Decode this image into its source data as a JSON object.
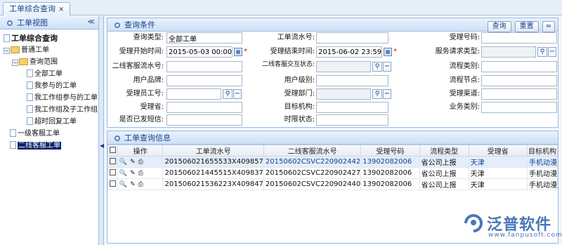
{
  "tab": {
    "title": "工单综合查询",
    "close": "×"
  },
  "left": {
    "title": "工单视图",
    "collapse": "≪",
    "tree": [
      {
        "label": "工单综合查询",
        "level": 0
      },
      {
        "label": "普通工单",
        "level": 1
      },
      {
        "label": "查询范围",
        "level": 2
      },
      {
        "label": "全部工单",
        "level": 3
      },
      {
        "label": "我参与的工单",
        "level": 3
      },
      {
        "label": "我工作组参与的工单",
        "level": 3
      },
      {
        "label": "我工作组及子工作组",
        "level": 3
      },
      {
        "label": "超时回复工单",
        "level": 3
      },
      {
        "label": "一级客服工单",
        "level": 1
      },
      {
        "label": "二线客服工单",
        "level": 1
      }
    ]
  },
  "query": {
    "title": "查询条件",
    "btn_query": "查询",
    "btn_reset": "重置",
    "btn_toggle": "≈",
    "labels": {
      "type": "查询类型:",
      "flow_no": "工单流水号:",
      "accept_no": "受理号码:",
      "start_time": "受理开始时间:",
      "end_time": "受理结束时间:",
      "service_type": "服务请求类型:",
      "l2_flow_no": "二线客服流水号:",
      "l2_interact": "二线客服交互状态:",
      "flow_type": "流程类别:",
      "brand": "用户品牌:",
      "level": "用户级别:",
      "flow_node": "流程节点:",
      "staff_no": "受理员工号:",
      "dept": "受理部门:",
      "channel": "受理渠道:",
      "province": "受理省:",
      "target_org": "目标机构:",
      "biz_type": "业务类别:",
      "sms_sent": "是否已发短信:",
      "timeout": "时限状态:"
    },
    "values": {
      "type": "全部工单",
      "start_time": "2015-05-03 00:00:00",
      "end_time": "2015-06-02 23:59:59"
    }
  },
  "result": {
    "title": "工单查询信息",
    "columns": [
      "操作",
      "工单流水号",
      "二线客服流水号",
      "受理号码",
      "流程类型",
      "受理省",
      "目标机构"
    ],
    "rows": [
      {
        "flow_no": "201506021655533X409857",
        "l2_no": "20150602CSVC220902442",
        "accept_no": "13902082006",
        "flow_type": "省公司上报",
        "province": "天津",
        "target": "手机动漫"
      },
      {
        "flow_no": "201506021445515X409837",
        "l2_no": "20150602CSVC220902427",
        "accept_no": "13902082006",
        "flow_type": "省公司上报",
        "province": "天津",
        "target": "手机动漫"
      },
      {
        "flow_no": "201506021536223X409847",
        "l2_no": "20150602CSVC220902440",
        "accept_no": "13902082006",
        "flow_type": "省公司上报",
        "province": "天津",
        "target": "手机动漫"
      }
    ]
  },
  "logo": {
    "brand": "泛普软件",
    "url": "www.fanpusoft.com"
  },
  "colors": {
    "accent": "#15428b",
    "header_bg": "#dfe8f6",
    "border": "#99bbe8",
    "selected": "#0a246a"
  }
}
